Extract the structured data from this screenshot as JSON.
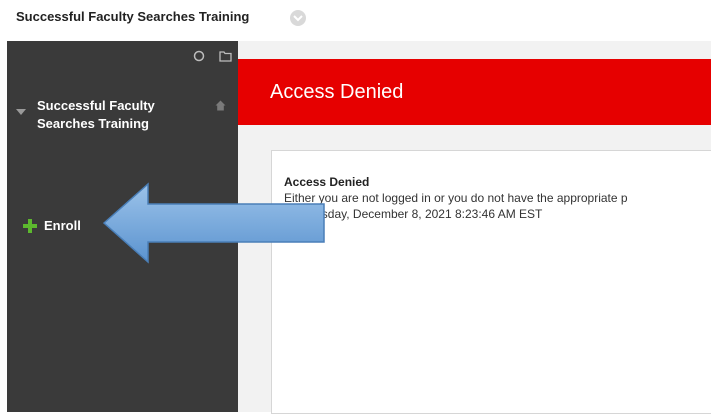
{
  "top": {
    "course_title": "Successful Faculty Searches Training"
  },
  "sidebar": {
    "course_name": "Successful Faculty Searches Training",
    "enroll_label": "Enroll"
  },
  "main": {
    "header_title": "Access Denied",
    "error_title": "Access Denied",
    "error_message": "Either you are not logged in or you do not have the appropriate p",
    "error_date": "Wednesday, December 8, 2021 8:23:46 AM EST"
  },
  "colors": {
    "header_red": "#e60000",
    "sidebar_dark": "#3a3a3a",
    "enroll_plus": "#5cb82e",
    "arrow_blue": "#6fa8dc"
  }
}
